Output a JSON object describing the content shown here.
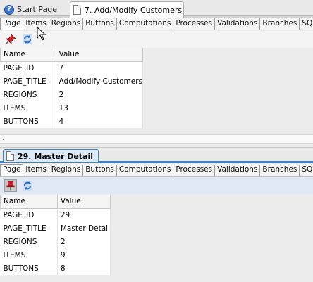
{
  "editor_tabs": {
    "start_page": "Start Page",
    "active": "7. Add/Modify Customers"
  },
  "panel1": {
    "subtabs": [
      "Page",
      "Items",
      "Regions",
      "Buttons",
      "Computations",
      "Processes",
      "Validations",
      "Branches",
      "SQL"
    ],
    "columns": {
      "name": "Name",
      "value": "Value"
    },
    "rows": [
      {
        "name": "PAGE_ID",
        "value": "7"
      },
      {
        "name": "PAGE_TITLE",
        "value": "Add/Modify Customers"
      },
      {
        "name": "REGIONS",
        "value": "2"
      },
      {
        "name": "ITEMS",
        "value": "13"
      },
      {
        "name": "BUTTONS",
        "value": "4"
      }
    ]
  },
  "panel2": {
    "tab_title": "29. Master Detail",
    "subtabs": [
      "Page",
      "Items",
      "Regions",
      "Buttons",
      "Computations",
      "Processes",
      "Validations",
      "Branches",
      "SQL"
    ],
    "columns": {
      "name": "Name",
      "value": "Value"
    },
    "rows": [
      {
        "name": "PAGE_ID",
        "value": "29"
      },
      {
        "name": "PAGE_TITLE",
        "value": "Master Detail"
      },
      {
        "name": "REGIONS",
        "value": "2"
      },
      {
        "name": "ITEMS",
        "value": "9"
      },
      {
        "name": "BUTTONS",
        "value": "8"
      }
    ]
  },
  "icons": {
    "pin": "pin-icon",
    "refresh": "refresh-icon",
    "help": "help-icon",
    "document": "document-icon"
  },
  "colors": {
    "pin_red": "#c8202a",
    "refresh_blue": "#2e6fc4",
    "active_tab_accent": "#3b82c9"
  }
}
